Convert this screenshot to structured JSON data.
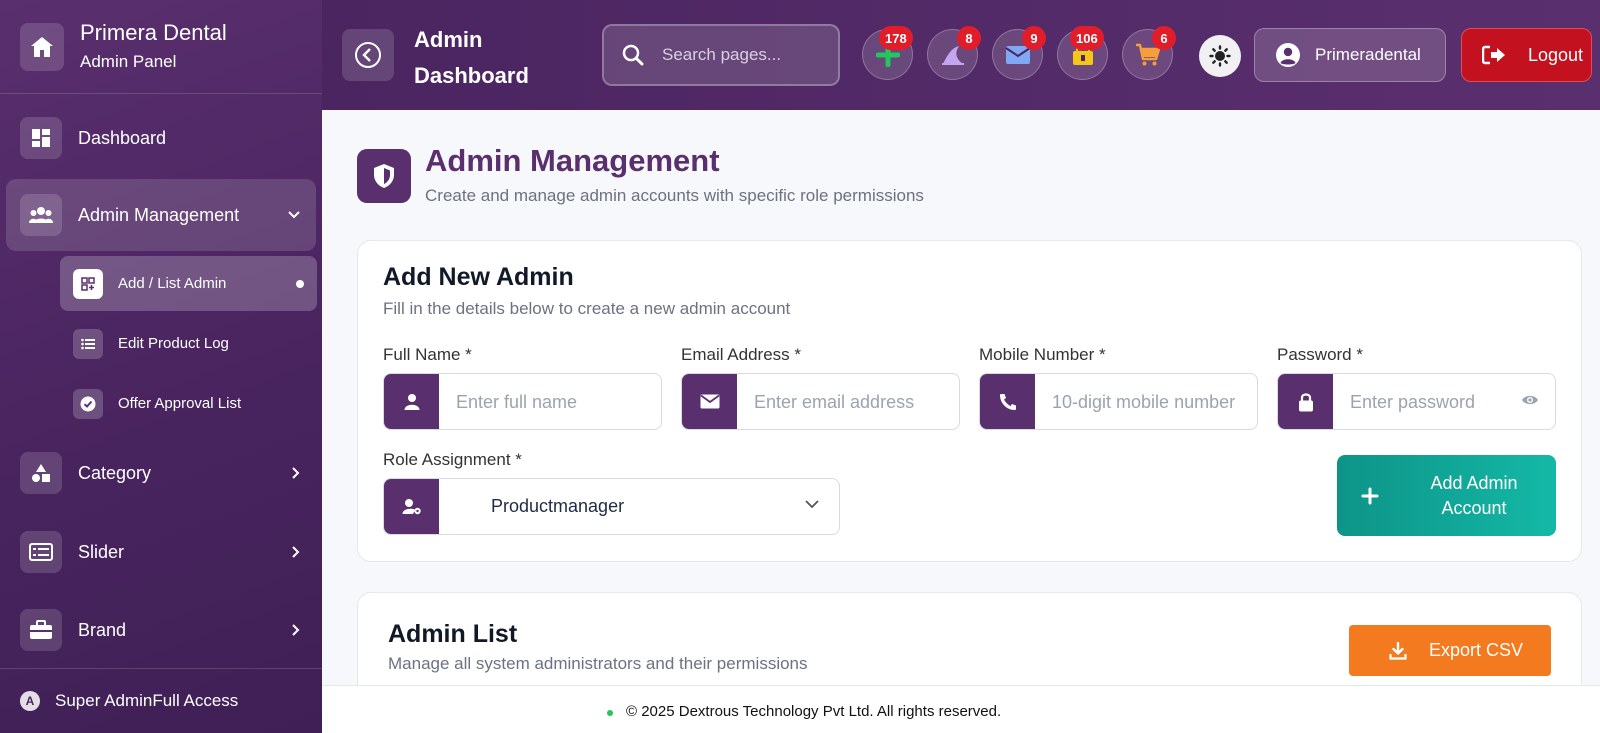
{
  "sidebar": {
    "brand_title": "Primera Dental",
    "brand_subtitle": "Admin Panel",
    "items": [
      {
        "label": "Dashboard",
        "icon": "dashboard-icon"
      },
      {
        "label": "Admin Management",
        "icon": "users-icon",
        "expanded": true
      },
      {
        "label": "Category",
        "icon": "shapes-icon"
      },
      {
        "label": "Slider",
        "icon": "slider-icon"
      },
      {
        "label": "Brand",
        "icon": "briefcase-icon"
      }
    ],
    "sub_items": [
      {
        "label": "Add / List Admin",
        "icon": "qr-add-icon",
        "active": true
      },
      {
        "label": "Edit Product Log",
        "icon": "list-icon"
      },
      {
        "label": "Offer Approval List",
        "icon": "check-circle-icon"
      }
    ],
    "footer_badge": "A",
    "footer_text": "Super AdminFull Access"
  },
  "header": {
    "title": "Admin Dashboard",
    "search_placeholder": "Search pages...",
    "notifications": [
      {
        "icon": "plus-icon",
        "count": "178",
        "color": "#22c55e"
      },
      {
        "icon": "shark-fin-icon",
        "count": "8",
        "color": "#c4a6f0"
      },
      {
        "icon": "envelope-icon",
        "count": "9",
        "color": "#7fa8f5"
      },
      {
        "icon": "box-icon",
        "count": "106",
        "color": "#f5c518"
      },
      {
        "icon": "cart-icon",
        "count": "6",
        "color": "#f59e3b"
      }
    ],
    "user_label": "Primeradental",
    "logout_label": "Logout"
  },
  "page": {
    "title": "Admin Management",
    "subtitle": "Create and manage admin accounts with specific role permissions"
  },
  "add_form": {
    "title": "Add New Admin",
    "subtitle": "Fill in the details below to create a new admin account",
    "full_name_label": "Full Name *",
    "full_name_placeholder": "Enter full name",
    "email_label": "Email Address *",
    "email_placeholder": "Enter email address",
    "mobile_label": "Mobile Number *",
    "mobile_placeholder": "10-digit mobile number",
    "password_label": "Password *",
    "password_placeholder": "Enter password",
    "role_label": "Role Assignment *",
    "role_value": "Productmanager",
    "submit_label": "Add Admin Account"
  },
  "admin_list": {
    "title": "Admin List",
    "subtitle": "Manage all system administrators and their permissions",
    "export_label": "Export CSV"
  },
  "footer": {
    "text": "© 2025 Dextrous Technology Pvt Ltd. All rights reserved."
  },
  "colors": {
    "primary": "#5a2f6e",
    "accent_teal": "#14b8a6",
    "export_orange": "#f47a1f",
    "logout_red": "#c4111f",
    "badge_red": "#e11d2a"
  }
}
